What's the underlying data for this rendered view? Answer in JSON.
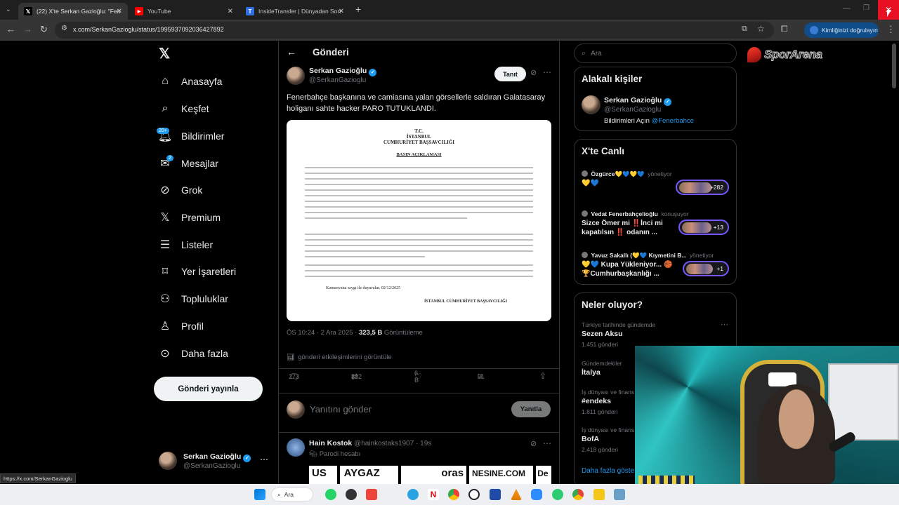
{
  "browser": {
    "tabs": [
      {
        "title": "(22) X'te Serkan Gazioğlu: \"Fen",
        "icon": "x-logo-icon",
        "active": true
      },
      {
        "title": "YouTube",
        "icon": "youtube-icon",
        "active": false
      },
      {
        "title": "InsideTransfer | Dünyadan Son",
        "icon": "insidetransfer-icon",
        "active": false
      }
    ],
    "url": "x.com/SerkanGazioglu/status/1995937092036427892",
    "verify_label": "Kimliğinizi doğrulayın",
    "status_url": "https://x.com/SerkanGazioglu"
  },
  "nav": {
    "items": [
      {
        "label": "Anasayfa",
        "icon": "home-icon"
      },
      {
        "label": "Keşfet",
        "icon": "search-icon"
      },
      {
        "label": "Bildirimler",
        "icon": "bell-icon",
        "badge": "20+"
      },
      {
        "label": "Mesajlar",
        "icon": "mail-icon",
        "badge": "2"
      },
      {
        "label": "Grok",
        "icon": "grok-icon"
      },
      {
        "label": "Premium",
        "icon": "x-logo-icon"
      },
      {
        "label": "Listeler",
        "icon": "list-icon"
      },
      {
        "label": "Yer İşaretleri",
        "icon": "bookmark-icon"
      },
      {
        "label": "Topluluklar",
        "icon": "people-icon"
      },
      {
        "label": "Profil",
        "icon": "person-icon"
      },
      {
        "label": "Daha fazla",
        "icon": "more-circle-icon"
      }
    ],
    "post_button": "Gönderi yayınla",
    "account": {
      "name": "Serkan Gazioğlu",
      "handle": "@SerkanGazioglu"
    }
  },
  "post": {
    "header": "Gönderi",
    "author": {
      "name": "Serkan Gazioğlu",
      "handle": "@SerkanGazioglu"
    },
    "follow_label": "Tanıt",
    "text": "Fenerbahçe başkanına ve camiasına yalan görsellerle saldıran Galatasaray holiganı sahte hacker PARO TUTUKLANDI.",
    "document": {
      "head1": "T.C.",
      "head2": "İSTANBUL",
      "head3": "CUMHURİYET BAŞSAVCILIĞI",
      "subtitle": "BASIN AÇIKLAMASI",
      "closing": "Kamuoyuna saygı ile duyurulur. 02/12/2025",
      "signature": "İSTANBUL CUMHURİYET BAŞSAVCILIĞI"
    },
    "time": "ÖS 10:24 · 2 Ara 2025 · ",
    "views_count": "323,5 B",
    "views_label": " Görüntüleme",
    "engagements": "gönderi etkileşimlerini görüntüle",
    "stats": {
      "replies": "273",
      "reposts": "802",
      "likes": "6 B",
      "bookmarks": "91"
    },
    "reply_placeholder": "Yanıtını gönder",
    "reply_button": "Yanıtla"
  },
  "reply": {
    "name": "Hain Kostok",
    "handle": "@hainkostaks1907 · 19s",
    "tag": "Parodi hesabı",
    "banner_texts": [
      "US",
      "AYGAZ",
      "oras",
      "NESINE.COM",
      "De"
    ]
  },
  "search": {
    "placeholder": "Ara"
  },
  "related": {
    "title": "Alakalı kişiler",
    "name": "Serkan Gazioğlu",
    "handle": "@SerkanGazioglu",
    "bio_prefix": "Bildirimleri Açın ",
    "bio_link": "@Fenerbahce"
  },
  "live": {
    "title": "X'te Canlı",
    "items": [
      {
        "host": "Özgürce💛💙💛💙",
        "role": "yönetiyor",
        "title": "💛💙",
        "count": "+282"
      },
      {
        "host": "Vedat Fenerbahçelioğlu",
        "role": "konuşuyor",
        "title": "Sizce Ömer mi ‼️İnci mi kapatılsın ‼️ odanın ...",
        "count": "+13"
      },
      {
        "host": "Yavuz Sakallı (💛💙 Kıymetini B...",
        "role": "yönetiyor",
        "title": "💛💙 Kupa Yükleniyor... 🏀 🏆Cumhurbaşkanlığı ...",
        "count": "+1"
      }
    ]
  },
  "trends": {
    "title": "Neler oluyor?",
    "items": [
      {
        "category": "Türkiye tarihinde gündemde",
        "name": "Sezen Aksu",
        "count": "1.451 gönderi"
      },
      {
        "category": "Gündemdekiler",
        "name": "İtalya",
        "count": ""
      },
      {
        "category": "İş dünyası ve finans",
        "name": "#endeks",
        "count": "1.811 gönderi"
      },
      {
        "category": "İş dünyası ve finans",
        "name": "BofA",
        "count": "2.418 gönderi"
      }
    ],
    "more": "Daha fazla göste"
  },
  "brand_logo_text": "SporArena",
  "taskbar": {
    "search": "Ara"
  }
}
